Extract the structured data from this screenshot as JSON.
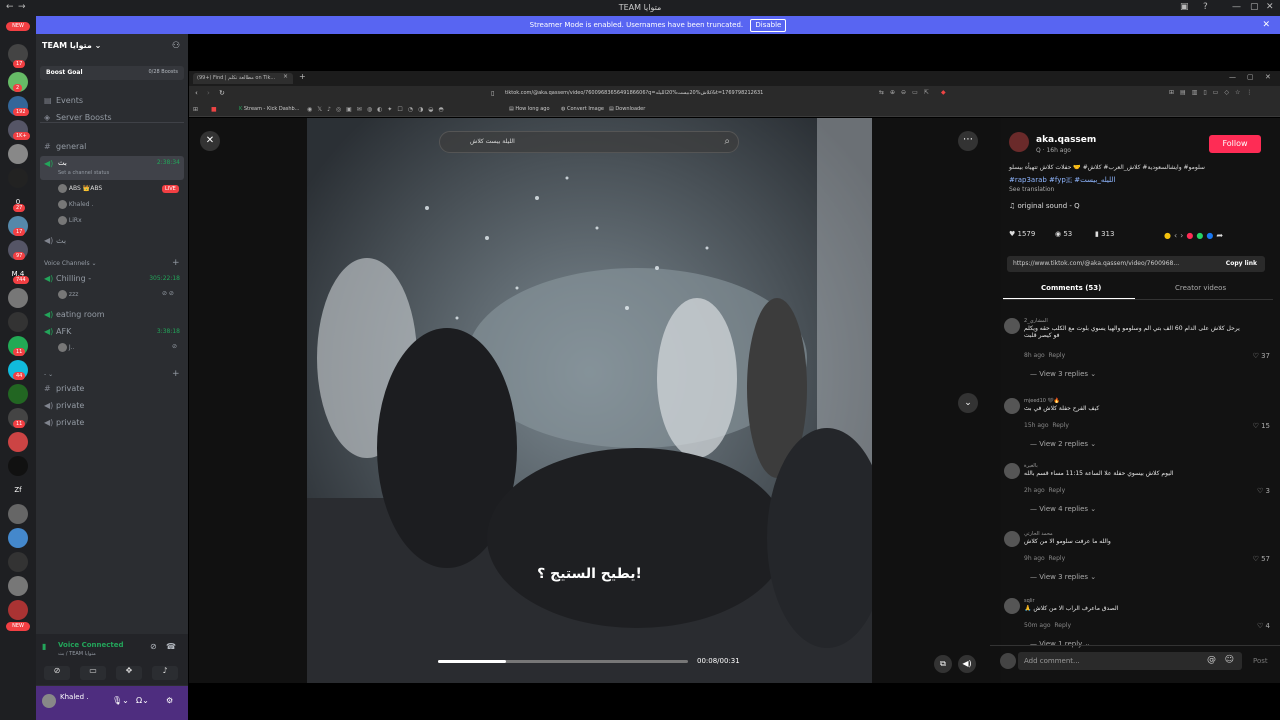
{
  "window": {
    "title": "TEAM متوايا"
  },
  "banner": {
    "text": "Streamer Mode is enabled. Usernames have been truncated.",
    "disable": "Disable"
  },
  "rail": {
    "new_top": "NEW",
    "badges": [
      "17",
      "2",
      "192",
      "1K+",
      "27",
      "17",
      "97",
      "744",
      "11",
      "44",
      "11"
    ],
    "letters": [
      "0",
      "M.4",
      "Zf"
    ],
    "new_bottom": "NEW"
  },
  "server": {
    "name": "TEAM متوايا",
    "boost_goal": "Boost Goal",
    "boost_count": "0/28 Boosts"
  },
  "sidebar": {
    "events": "Events",
    "server_boosts": "Server Boosts",
    "general": "general",
    "voice_bt": "بث",
    "voice_bt_time": "2:38:34",
    "voice_bt_status": "Set a channel status",
    "users": [
      "ABS 👑ABS",
      "Khaled .",
      "LiRx"
    ],
    "live": "LIVE",
    "bt2": "بث",
    "voice_channels": "Voice Channels",
    "chilling": "Chilling -",
    "chilling_time": "305:22:18",
    "chilling_user": "zzz",
    "eating": "eating room",
    "afk": "AFK",
    "afk_time": "3:38:18",
    "afk_user": "J..",
    "private": [
      "private",
      "private",
      "private"
    ]
  },
  "voice_panel": {
    "status": "Voice Connected",
    "channel": "بث / TEAM متوايا",
    "user": "Khaled ."
  },
  "browser": {
    "tab": "(99+) Find | مطالعة تكلم on Tik...",
    "url": "tiktok.com/@aka.qassem/video/7600968365649186606?q=كلاش%20بيست%20الليله&t=1769798212631",
    "bookmarks": [
      "Stream - Kick Dashb...",
      "How long ago",
      "Convert Image",
      "Downloader"
    ]
  },
  "tiktok": {
    "search": "الليلة بيست كلاش",
    "subtitle": "يطيح الستيج ؟!",
    "progress": 0.27,
    "time": "00:08/00:31",
    "author": "aka.qassem",
    "author_meta": "Q · 16h ago",
    "follow": "Follow",
    "caption": "سلومو# وايشالسعودية# كلاش_العرب# كلاش# 🤝 حفلات كلاش تتهيأه بيسلو",
    "hashtags": "#rap3arab #fyp🇪 #الليله_بيست",
    "see_translation": "See translation",
    "sound": "original sound - Q",
    "likes": "1579",
    "comments_count": "53",
    "saves": "313",
    "link": "https://www.tiktok.com/@aka.qassem/video/7600968...",
    "copy_link": "Copy link",
    "tab_comments": "Comments (53)",
    "tab_creator": "Creator videos",
    "add_comment": "Add comment...",
    "post": "Post",
    "comments": [
      {
        "name": "المشاري_2",
        "text": "يرحل كلاش على الدام 60 الف بتي الم وسلومو والهيا يسوي بلوت مع الكلب حقه ويكلم فو كيصر قلبت",
        "ago": "8h ago",
        "likes": "37",
        "replies": "View 3 replies"
      },
      {
        "name": "mjeed10 🖤🔥",
        "text": "كيف الفرح حفلة كلاش في بث",
        "ago": "15h ago",
        "likes": "15",
        "replies": "View 2 replies"
      },
      {
        "name": "بالغيرة",
        "text": "اليوم كلاش بيسوي حفلة علا الساعة 11:15 مساء قسم بالله",
        "ago": "2h ago",
        "likes": "3",
        "replies": "View 4 replies"
      },
      {
        "name": "محمد الحارثي",
        "text": "والله ما عرفت سلومو الا من كلاش",
        "ago": "9h ago",
        "likes": "57",
        "replies": "View 3 replies"
      },
      {
        "name": "sqlir",
        "text": "الصدق ماعرف الراب الا من كلاش 🙏",
        "ago": "50m ago",
        "likes": "4",
        "replies": "View 1 reply"
      }
    ],
    "reply": "Reply"
  }
}
